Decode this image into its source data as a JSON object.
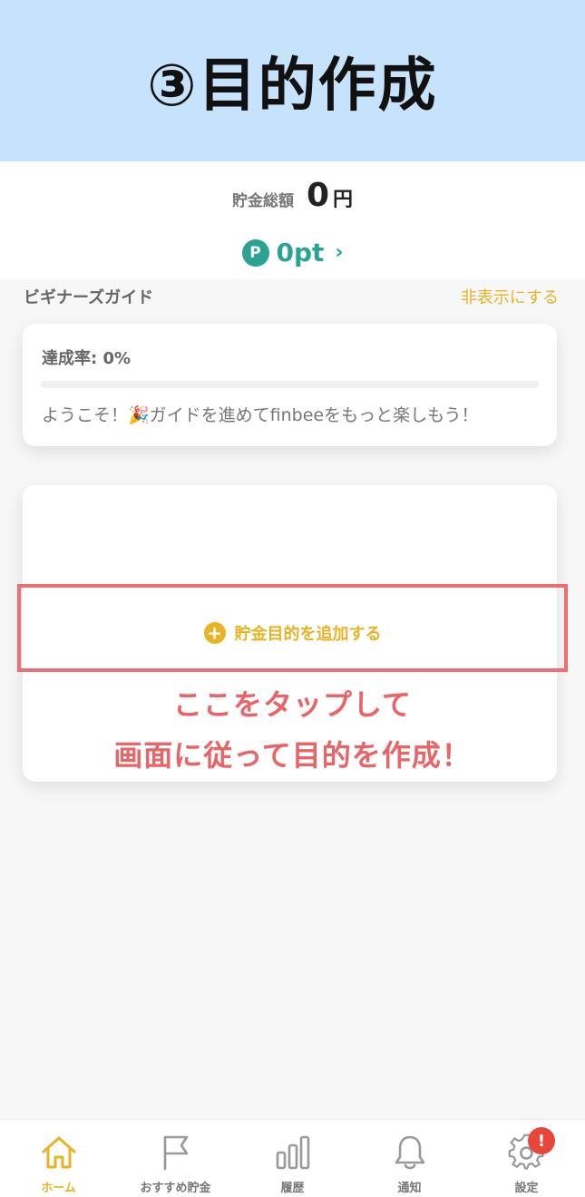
{
  "banner": {
    "title": "③目的作成"
  },
  "summary": {
    "total_label": "貯金総額",
    "total_amount": "0",
    "total_unit": "円",
    "points_icon": "P",
    "points_value": "0pt",
    "points_chevron": "›"
  },
  "guide": {
    "title": "ビギナーズガイド",
    "hide_label": "非表示にする",
    "rate_label": "達成率: 0%",
    "progress": 0,
    "welcome": "ようこそ！🎉ガイドを進めてfinbeeをもっと楽しもう！"
  },
  "goal": {
    "plus_icon": "+",
    "add_label": "貯金目的を追加する"
  },
  "instruction": {
    "line1": "ここをタップして",
    "line2": "画面に従って目的を作成！"
  },
  "tabs": [
    {
      "label": "ホーム",
      "icon": "home-icon",
      "active": true
    },
    {
      "label": "おすすめ貯金",
      "icon": "flag-icon",
      "active": false
    },
    {
      "label": "履歴",
      "icon": "bar-chart-icon",
      "active": false
    },
    {
      "label": "通知",
      "icon": "bell-icon",
      "active": false
    },
    {
      "label": "設定",
      "icon": "gear-icon",
      "active": false,
      "badge": "!"
    }
  ],
  "colors": {
    "accent": "#e9b325",
    "points": "#2aa393",
    "banner": "#c6e3fb",
    "highlight": "#eb6f73",
    "badge": "#e6473a"
  }
}
